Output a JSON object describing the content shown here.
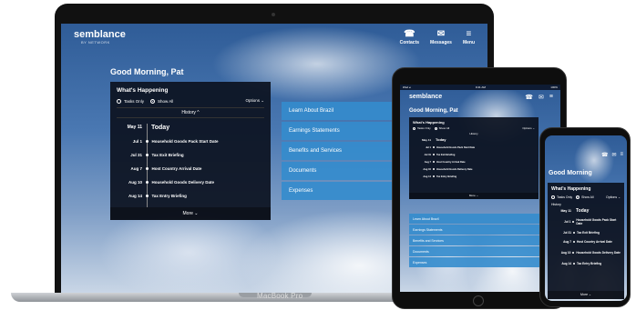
{
  "app": {
    "brand": "semblance",
    "brand_sub": "BY NETWORK"
  },
  "nav": [
    {
      "label": "Contacts",
      "icon": "contacts-icon"
    },
    {
      "label": "Messages",
      "icon": "messages-icon"
    },
    {
      "label": "Menu",
      "icon": "menu-icon"
    }
  ],
  "greeting": "Good Morning, Pat",
  "happening": {
    "title": "What's Happening",
    "tasks_only": "Tasks Only",
    "show_all": "Show All",
    "options": "Options ⌄",
    "history": "History ^",
    "history_phone": "History",
    "more": "More ⌄",
    "today_date": "May 11",
    "today_label": "Today",
    "events": [
      {
        "date": "Jul 1",
        "text": "Household Goods Pack Start Date"
      },
      {
        "date": "Jul 31",
        "text": "Tax Exit Briefing"
      },
      {
        "date": "Aug 7",
        "text": "Host Country Arrival Date"
      },
      {
        "date": "Aug 10",
        "text": "Household Goods Delivery Date"
      },
      {
        "date": "Aug 14",
        "text": "Tax Entry Briefing"
      }
    ]
  },
  "side_menu": [
    "Learn About Brazil",
    "Earnings Statements",
    "Benefits and Services",
    "Documents",
    "Expenses"
  ],
  "laptop_label": "MacBook Pro",
  "tablet_status": {
    "carrier": "iPad ◂",
    "time": "9:41 AM",
    "battery": "100%"
  },
  "phone_partial_greeting": "Good Morning"
}
